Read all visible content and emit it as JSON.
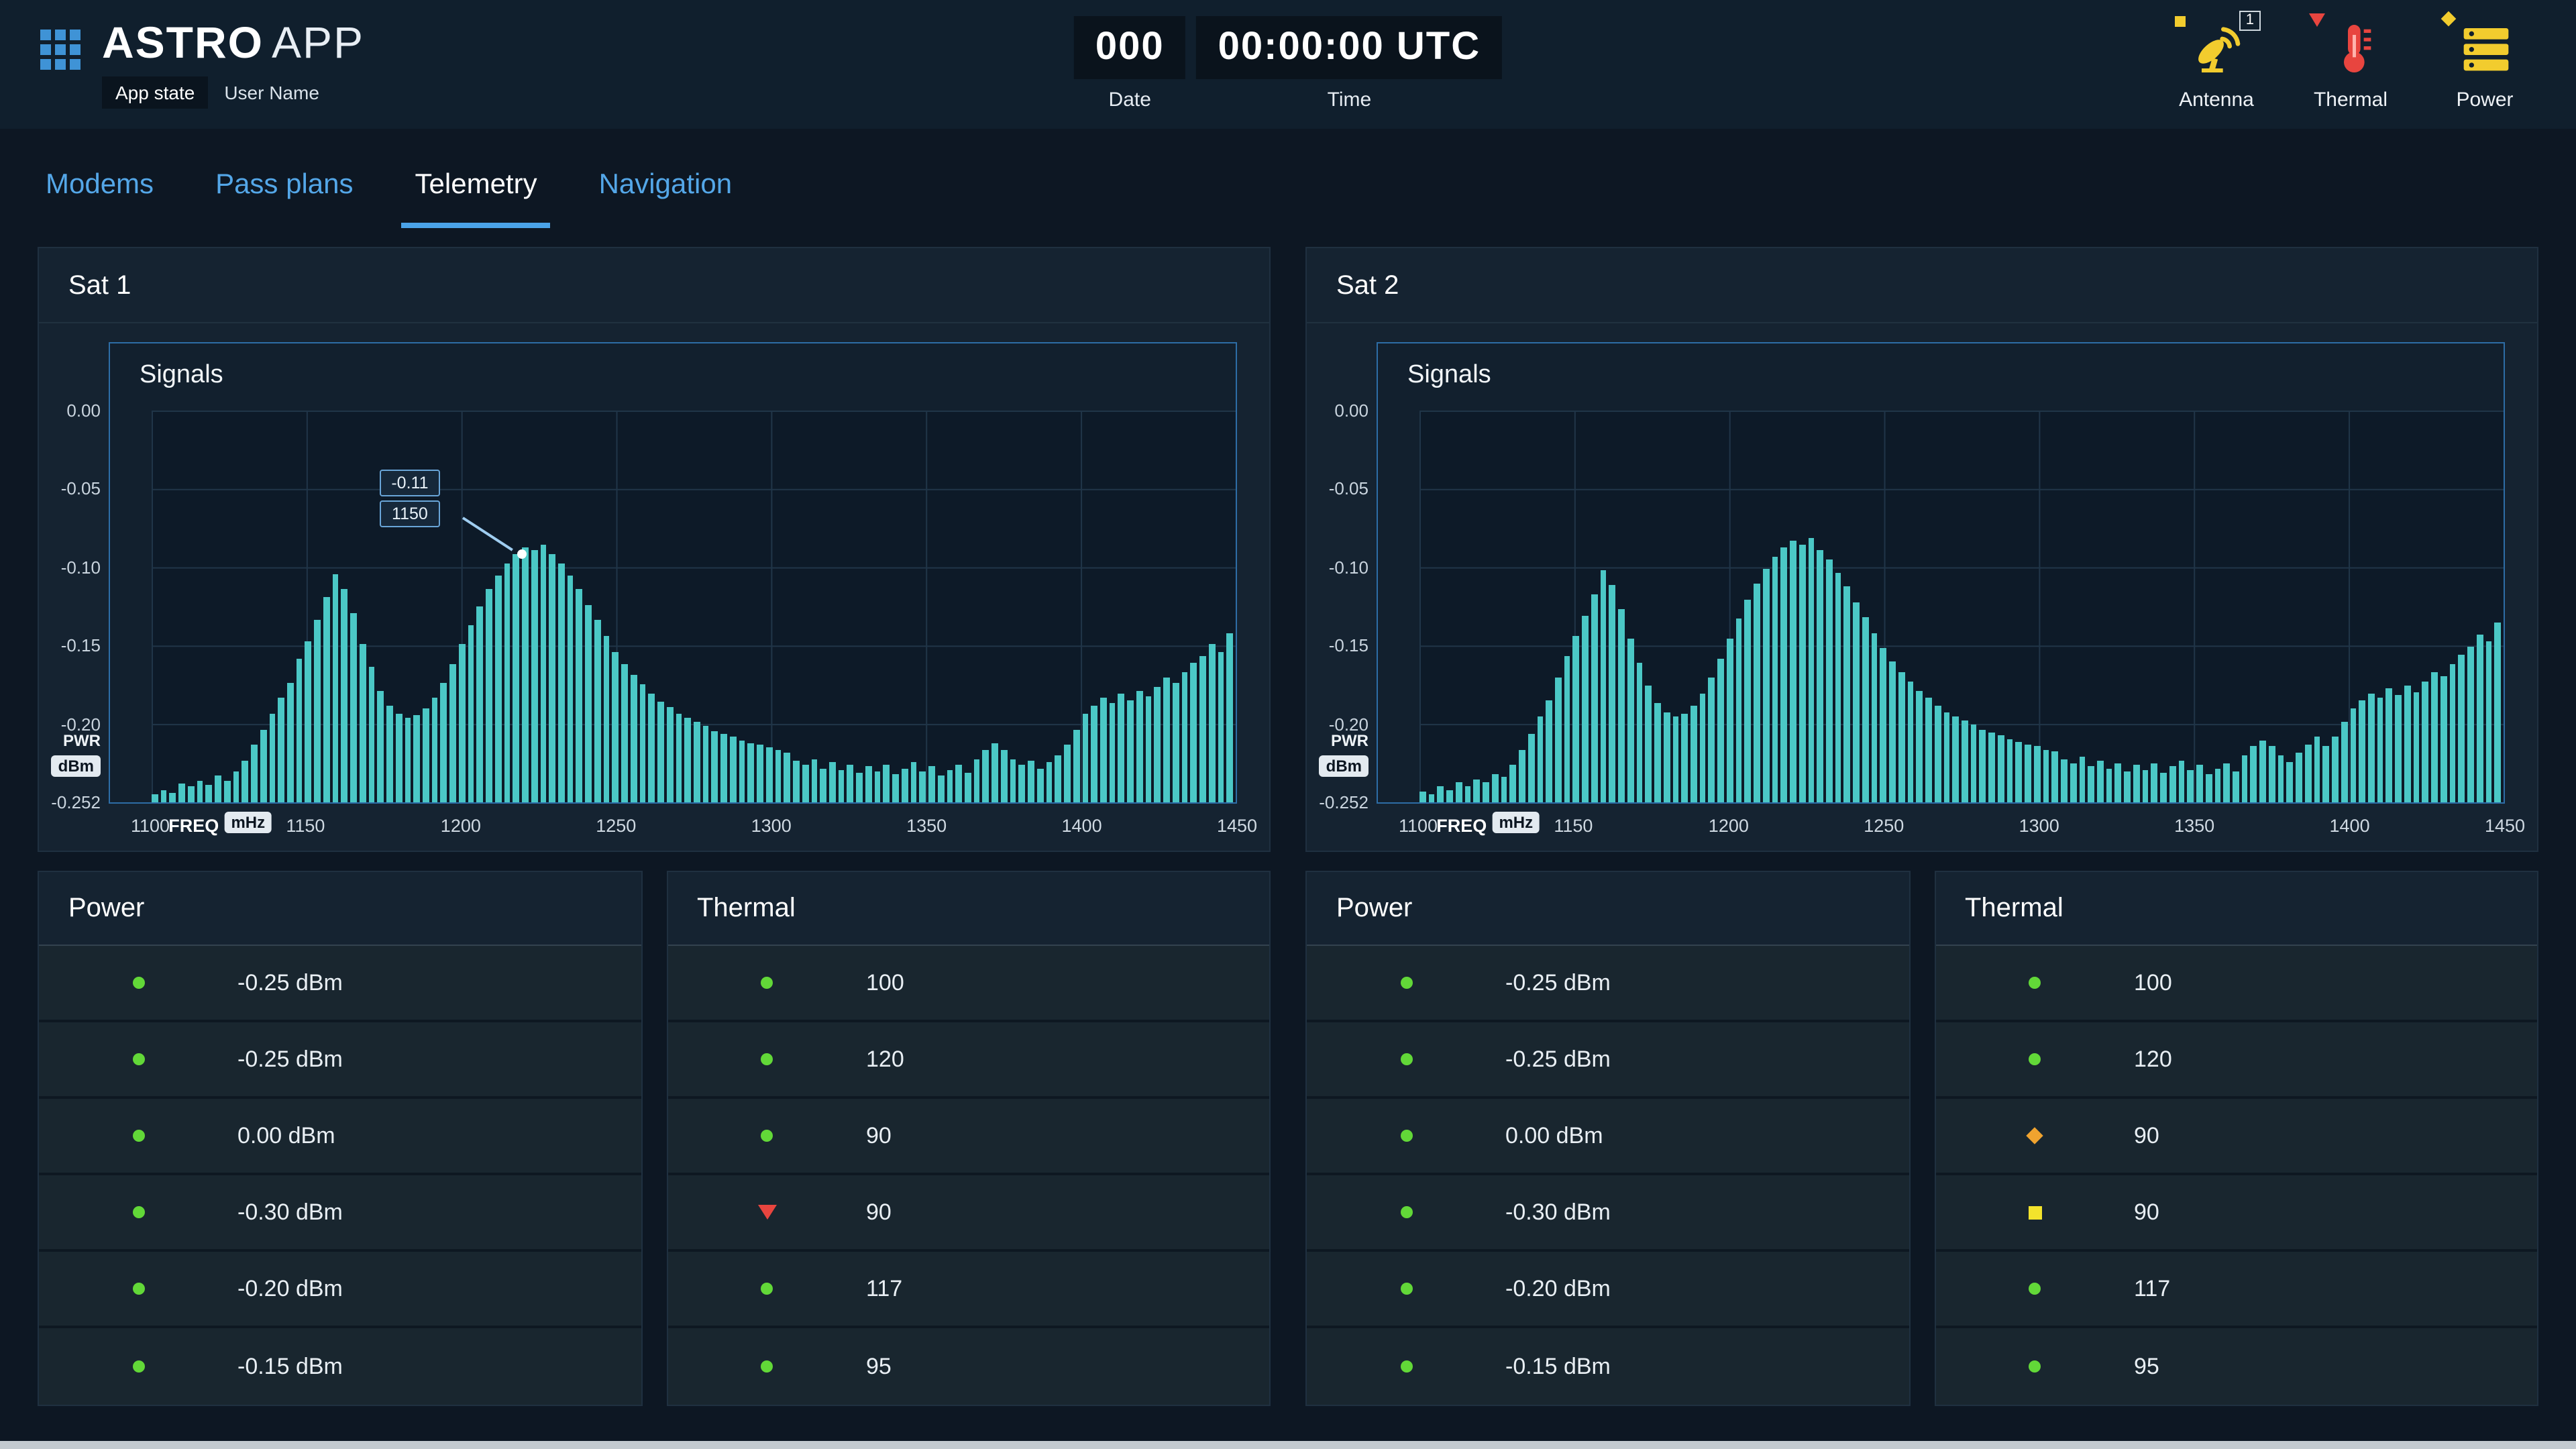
{
  "header": {
    "app_name": "ASTRO",
    "app_name_suffix": "APP",
    "app_state": "App state",
    "user_name": "User Name",
    "date": {
      "value": "000",
      "label": "Date"
    },
    "time": {
      "value": "00:00:00 UTC",
      "label": "Time"
    },
    "status": {
      "antenna": {
        "label": "Antenna",
        "badge": "1"
      },
      "thermal": {
        "label": "Thermal"
      },
      "power": {
        "label": "Power"
      }
    }
  },
  "tabs": [
    {
      "label": "Modems",
      "active": false
    },
    {
      "label": "Pass plans",
      "active": false
    },
    {
      "label": "Telemetry",
      "active": true
    },
    {
      "label": "Navigation",
      "active": false
    }
  ],
  "colors": {
    "accent_blue": "#4aa3e8",
    "bar_teal": "#4bc8c6",
    "ok_green": "#62d838",
    "alert_red": "#e8453f",
    "warn_orange": "#f0a32f",
    "warn_yellow": "#f3e32c",
    "icon_yellow": "#f2cc2e"
  },
  "axis": {
    "y_ticks": [
      "0.00",
      "-0.05",
      "-0.10",
      "-0.15",
      "-0.20",
      "-0.252"
    ],
    "y_unit_line1": "PWR",
    "y_unit_badge": "dBm",
    "x_ticks": [
      "1100",
      "1150",
      "1200",
      "1250",
      "1300",
      "1350",
      "1400",
      "1450"
    ],
    "x_label": "FREQ",
    "x_unit_badge": "mHz"
  },
  "satellites": [
    {
      "title": "Sat 1",
      "signals_title": "Signals",
      "tooltip": {
        "value": "-0.11",
        "freq": "1150"
      },
      "power": {
        "title": "Power",
        "rows": [
          {
            "status": "ok",
            "value": "-0.25 dBm"
          },
          {
            "status": "ok",
            "value": "-0.25 dBm"
          },
          {
            "status": "ok",
            "value": "0.00 dBm"
          },
          {
            "status": "ok",
            "value": "-0.30 dBm"
          },
          {
            "status": "ok",
            "value": "-0.20 dBm"
          },
          {
            "status": "ok",
            "value": "-0.15 dBm"
          }
        ]
      },
      "thermal": {
        "title": "Thermal",
        "rows": [
          {
            "status": "ok",
            "value": "100"
          },
          {
            "status": "ok",
            "value": "120"
          },
          {
            "status": "ok",
            "value": "90"
          },
          {
            "status": "tri",
            "value": "90"
          },
          {
            "status": "ok",
            "value": "117"
          },
          {
            "status": "ok",
            "value": "95"
          }
        ]
      }
    },
    {
      "title": "Sat 2",
      "signals_title": "Signals",
      "tooltip": null,
      "power": {
        "title": "Power",
        "rows": [
          {
            "status": "ok",
            "value": "-0.25 dBm"
          },
          {
            "status": "ok",
            "value": "-0.25 dBm"
          },
          {
            "status": "ok",
            "value": "0.00 dBm"
          },
          {
            "status": "ok",
            "value": "-0.30 dBm"
          },
          {
            "status": "ok",
            "value": "-0.20 dBm"
          },
          {
            "status": "ok",
            "value": "-0.15 dBm"
          }
        ]
      },
      "thermal": {
        "title": "Thermal",
        "rows": [
          {
            "status": "ok",
            "value": "100"
          },
          {
            "status": "ok",
            "value": "120"
          },
          {
            "status": "diamond",
            "value": "90"
          },
          {
            "status": "square",
            "value": "90"
          },
          {
            "status": "ok",
            "value": "117"
          },
          {
            "status": "ok",
            "value": "95"
          }
        ]
      }
    }
  ],
  "chart_data": [
    {
      "type": "bar",
      "title": "Signals",
      "xlabel": "FREQ (mHz)",
      "ylabel": "PWR (dBm)",
      "x_start": 1100,
      "x_end": 1450,
      "ylim": [
        -0.252,
        0
      ],
      "grid": true,
      "annotation": {
        "freq": 1150,
        "value": -0.11
      },
      "values": [
        -0.247,
        -0.244,
        -0.246,
        -0.24,
        -0.242,
        -0.238,
        -0.241,
        -0.235,
        -0.238,
        -0.232,
        -0.225,
        -0.215,
        -0.205,
        -0.195,
        -0.185,
        -0.175,
        -0.16,
        -0.148,
        -0.135,
        -0.12,
        -0.105,
        -0.115,
        -0.13,
        -0.15,
        -0.165,
        -0.18,
        -0.19,
        -0.195,
        -0.198,
        -0.196,
        -0.192,
        -0.185,
        -0.175,
        -0.163,
        -0.15,
        -0.138,
        -0.126,
        -0.115,
        -0.106,
        -0.098,
        -0.092,
        -0.088,
        -0.09,
        -0.086,
        -0.092,
        -0.098,
        -0.106,
        -0.115,
        -0.125,
        -0.135,
        -0.145,
        -0.155,
        -0.163,
        -0.17,
        -0.176,
        -0.182,
        -0.187,
        -0.191,
        -0.195,
        -0.198,
        -0.2,
        -0.203,
        -0.206,
        -0.208,
        -0.21,
        -0.212,
        -0.214,
        -0.215,
        -0.217,
        -0.218,
        -0.22,
        -0.225,
        -0.228,
        -0.224,
        -0.23,
        -0.226,
        -0.231,
        -0.228,
        -0.233,
        -0.229,
        -0.232,
        -0.228,
        -0.234,
        -0.23,
        -0.226,
        -0.232,
        -0.229,
        -0.235,
        -0.231,
        -0.228,
        -0.233,
        -0.224,
        -0.218,
        -0.214,
        -0.218,
        -0.224,
        -0.228,
        -0.225,
        -0.23,
        -0.226,
        -0.222,
        -0.215,
        -0.205,
        -0.195,
        -0.19,
        -0.185,
        -0.188,
        -0.182,
        -0.186,
        -0.18,
        -0.184,
        -0.178,
        -0.172,
        -0.175,
        -0.168,
        -0.162,
        -0.158,
        -0.15,
        -0.155,
        -0.143
      ]
    },
    {
      "type": "bar",
      "title": "Signals",
      "xlabel": "FREQ (mHz)",
      "ylabel": "PWR (dBm)",
      "x_start": 1100,
      "x_end": 1450,
      "ylim": [
        -0.252,
        0
      ],
      "grid": true,
      "annotation": null,
      "values": [
        -0.245,
        -0.247,
        -0.242,
        -0.244,
        -0.239,
        -0.242,
        -0.237,
        -0.239,
        -0.234,
        -0.236,
        -0.228,
        -0.218,
        -0.208,
        -0.197,
        -0.186,
        -0.172,
        -0.158,
        -0.145,
        -0.132,
        -0.118,
        -0.103,
        -0.112,
        -0.128,
        -0.147,
        -0.162,
        -0.177,
        -0.188,
        -0.194,
        -0.197,
        -0.195,
        -0.19,
        -0.182,
        -0.172,
        -0.16,
        -0.147,
        -0.134,
        -0.122,
        -0.111,
        -0.102,
        -0.094,
        -0.088,
        -0.084,
        -0.086,
        -0.082,
        -0.09,
        -0.096,
        -0.104,
        -0.113,
        -0.123,
        -0.133,
        -0.143,
        -0.153,
        -0.161,
        -0.168,
        -0.174,
        -0.18,
        -0.185,
        -0.19,
        -0.194,
        -0.197,
        -0.199,
        -0.202,
        -0.205,
        -0.207,
        -0.209,
        -0.211,
        -0.213,
        -0.215,
        -0.216,
        -0.218,
        -0.219,
        -0.224,
        -0.227,
        -0.223,
        -0.229,
        -0.225,
        -0.23,
        -0.227,
        -0.232,
        -0.228,
        -0.231,
        -0.227,
        -0.233,
        -0.229,
        -0.225,
        -0.231,
        -0.228,
        -0.234,
        -0.23,
        -0.227,
        -0.232,
        -0.222,
        -0.216,
        -0.212,
        -0.216,
        -0.222,
        -0.226,
        -0.22,
        -0.215,
        -0.21,
        -0.216,
        -0.21,
        -0.2,
        -0.192,
        -0.186,
        -0.182,
        -0.185,
        -0.179,
        -0.183,
        -0.177,
        -0.181,
        -0.174,
        -0.168,
        -0.171,
        -0.163,
        -0.157,
        -0.152,
        -0.144,
        -0.148,
        -0.136
      ]
    }
  ]
}
